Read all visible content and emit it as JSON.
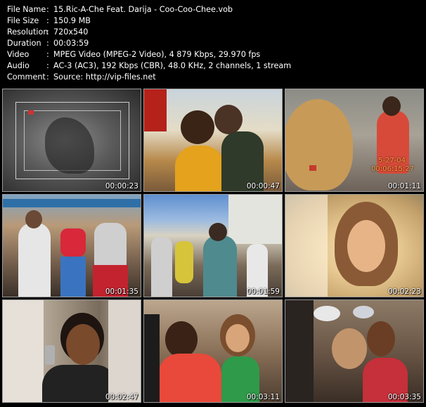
{
  "info": [
    {
      "label": "File Name",
      "value": "15.Ric-A-Che Feat. Darija - Coo-Coo-Chee.vob"
    },
    {
      "label": "File Size",
      "value": "150.9 MB"
    },
    {
      "label": "Resolution",
      "value": "720x540"
    },
    {
      "label": "Duration",
      "value": "00:03:59"
    },
    {
      "label": "Video",
      "value": "MPEG Video (MPEG-2 Video), 4 879 Kbps, 29.970 fps"
    },
    {
      "label": "Audio",
      "value": "AC-3 (AC3), 192 Kbps (CBR), 48.0 KHz, 2 channels, 1 stream"
    },
    {
      "label": "Comment",
      "value": "Source: http://vip-files.net"
    }
  ],
  "separator": ":",
  "thumbnails": [
    {
      "time": "00:00:23",
      "scene": "grayscale-tv-frame"
    },
    {
      "time": "00:00:47",
      "scene": "beach-men-dancing"
    },
    {
      "time": "00:01:11",
      "scene": "boardwalk-crowd"
    },
    {
      "time": "00:01:35",
      "scene": "street-dancers"
    },
    {
      "time": "00:01:59",
      "scene": "sunny-street-crowd"
    },
    {
      "time": "00:02:23",
      "scene": "woman-closeup-bright"
    },
    {
      "time": "00:02:47",
      "scene": "man-with-phone"
    },
    {
      "time": "00:03:11",
      "scene": "man-and-woman-dancing"
    },
    {
      "time": "00:03:35",
      "scene": "crowd-closeup"
    }
  ],
  "overlay_date": "5-27-04",
  "overlay_clock": "00:06:15:27"
}
